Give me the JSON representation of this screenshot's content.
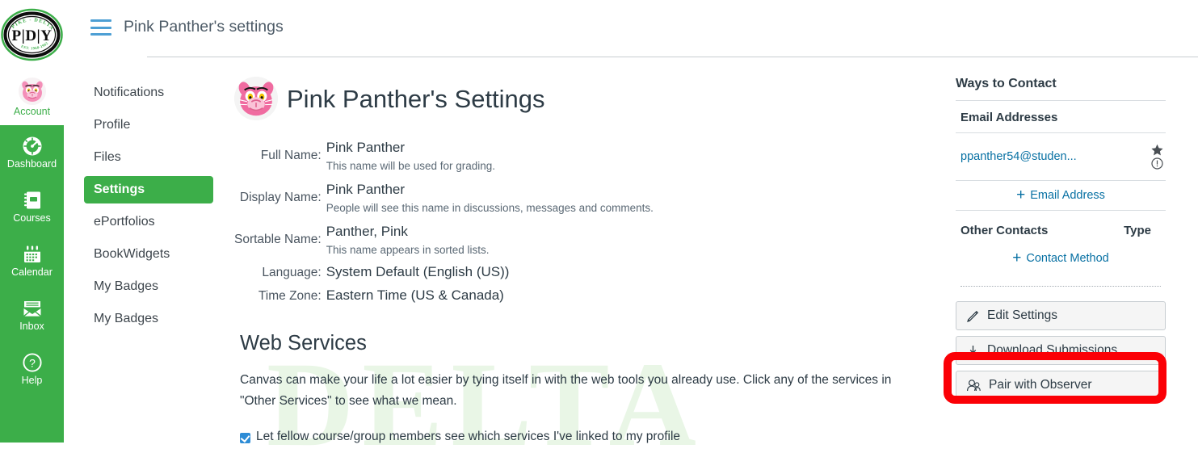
{
  "theme": {
    "brand_green": "#3cae49",
    "link_blue": "#0770a3",
    "hamburger_blue": "#4d9fd4",
    "checkbox_blue": "#2d8cd6",
    "highlight_red": "#fb0006",
    "watermark_green": "#e9f6e6",
    "text_dark": "#2d3b45"
  },
  "watermark": {
    "text": "DELTA"
  },
  "rail": {
    "logo": {
      "icon": "pdy-crest-logo",
      "initials": "P|D|Y",
      "top_arc_text": "PIKE  -  DELTA  -  YORK",
      "bottom_arc_text": "EST. 1968-1962"
    },
    "account": {
      "label": "Account",
      "icon": "user-avatar-pink-panther"
    },
    "items": [
      {
        "label": "Dashboard",
        "icon": "dashboard-gauge-icon"
      },
      {
        "label": "Courses",
        "icon": "courses-book-icon"
      },
      {
        "label": "Calendar",
        "icon": "calendar-icon"
      },
      {
        "label": "Inbox",
        "icon": "inbox-envelope-icon"
      },
      {
        "label": "Help",
        "icon": "help-question-circle-icon"
      }
    ]
  },
  "header": {
    "menu_icon": "hamburger-menu-icon",
    "breadcrumb": "Pink Panther's settings"
  },
  "subnav": {
    "items": [
      {
        "label": "Notifications",
        "active": false
      },
      {
        "label": "Profile",
        "active": false
      },
      {
        "label": "Files",
        "active": false
      },
      {
        "label": "Settings",
        "active": true
      },
      {
        "label": "ePortfolios",
        "active": false
      },
      {
        "label": "BookWidgets",
        "active": false
      },
      {
        "label": "My Badges",
        "active": false
      },
      {
        "label": "My Badges",
        "active": false
      }
    ]
  },
  "main": {
    "avatar_icon": "user-avatar-pink-panther",
    "page_title": "Pink Panther's Settings",
    "fields": [
      {
        "label": "Full Name:",
        "value": "Pink Panther",
        "hint": "This name will be used for grading."
      },
      {
        "label": "Display Name:",
        "value": "Pink Panther",
        "hint": "People will see this name in discussions, messages and comments."
      },
      {
        "label": "Sortable Name:",
        "value": "Panther, Pink",
        "hint": "This name appears in sorted lists."
      },
      {
        "label": "Language:",
        "value": "System Default (English (US))",
        "hint": ""
      },
      {
        "label": "Time Zone:",
        "value": "Eastern Time (US & Canada)",
        "hint": ""
      }
    ],
    "web_services": {
      "heading": "Web Services",
      "paragraph": "Canvas can make your life a lot easier by tying itself in with the web tools you already use. Click any of the services in \"Other Services\" to see what we mean.",
      "checkbox_label": "Let fellow course/group members see which services I've linked to my profile",
      "checkbox_checked": true
    }
  },
  "right_sidebar": {
    "ways_to_contact_title": "Ways to Contact",
    "email_section_title": "Email Addresses",
    "email": {
      "address": "ppanther54@studen...",
      "star_icon": "star-default-icon",
      "warning_icon": "unconfirmed-warning-icon"
    },
    "add_email_label": "Email Address",
    "add_email_icon": "plus-icon",
    "other_contacts_title": "Other Contacts",
    "type_column_title": "Type",
    "add_contact_label": "Contact Method",
    "add_contact_icon": "plus-icon",
    "buttons": [
      {
        "label": "Edit Settings",
        "icon": "pencil-edit-icon"
      },
      {
        "label": "Download Submissions",
        "icon": "download-arrow-icon"
      },
      {
        "label": "Pair with Observer",
        "icon": "observer-people-icon",
        "highlighted": true
      }
    ]
  }
}
